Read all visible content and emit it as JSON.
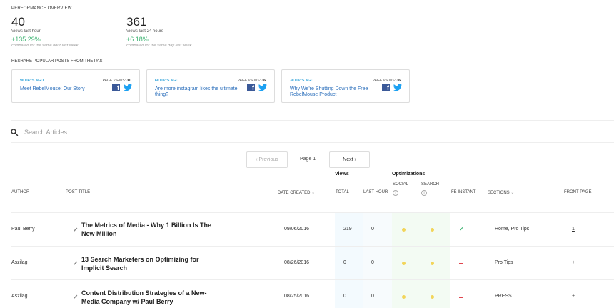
{
  "overview": {
    "label": "PERFORMANCE OVERVIEW",
    "stats": [
      {
        "value": "40",
        "label": "Views last hour",
        "change": "+135.29%",
        "compare": "compared for the same hour last week"
      },
      {
        "value": "361",
        "label": "Views last 24 hours",
        "change": "+6.18%",
        "compare": "compared for the same day last week"
      }
    ]
  },
  "reshare": {
    "label": "RESHARE POPULAR POSTS FROM THE PAST",
    "page_views_label": "PAGE VIEWS:",
    "cards": [
      {
        "ago": "90 DAYS AGO",
        "views": "31",
        "title": "Meet RebelMouse: Our Story"
      },
      {
        "ago": "60 DAYS AGO",
        "views": "36",
        "title": "Are more instagram likes the ultimate thing?"
      },
      {
        "ago": "30 DAYS AGO",
        "views": "36",
        "title": "Why We're Shutting Down the Free RebelMouse Product"
      }
    ]
  },
  "search": {
    "placeholder": "Search Articles..."
  },
  "pager": {
    "previous": "‹  Previous",
    "page": "Page 1",
    "next": "Next  ›"
  },
  "table": {
    "groups": {
      "views": "Views",
      "optimizations": "Optimizations"
    },
    "columns": {
      "author": "AUTHOR",
      "post_title": "POST TITLE",
      "date_created": "DATE CREATED",
      "total": "TOTAL",
      "last_hour": "LAST HOUR",
      "social": "SOCIAL",
      "search": "SEARCH",
      "fb_instant": "FB INSTANT",
      "sections": "SECTIONS",
      "front_page": "FRONT PAGE"
    },
    "rows": [
      {
        "author": "Paul Berry",
        "title": "The Metrics of Media - Why 1 Billion Is The New Million",
        "date": "09/06/2016",
        "total": "219",
        "last_hour": "0",
        "fb_instant": "check",
        "sections": "Home, Pro Tips",
        "front_page": "1"
      },
      {
        "author": "Aszilag",
        "title": "13 Search Marketers on Optimizing for Implicit Search",
        "date": "08/26/2016",
        "total": "0",
        "last_hour": "0",
        "fb_instant": "minus",
        "sections": "Pro Tips",
        "front_page": "+"
      },
      {
        "author": "Aszilag",
        "title": "Content Distribution Strategies of a New-Media Company w/ Paul Berry",
        "date": "08/25/2016",
        "total": "0",
        "last_hour": "0",
        "fb_instant": "minus",
        "sections": "PRESS",
        "front_page": "+"
      }
    ]
  },
  "colors": {
    "accent": "#2aa0d8",
    "positive": "#3cb371",
    "negative": "#e0454f",
    "dot": "#f2d55a",
    "facebook": "#3b5998",
    "twitter": "#1da1f2"
  }
}
